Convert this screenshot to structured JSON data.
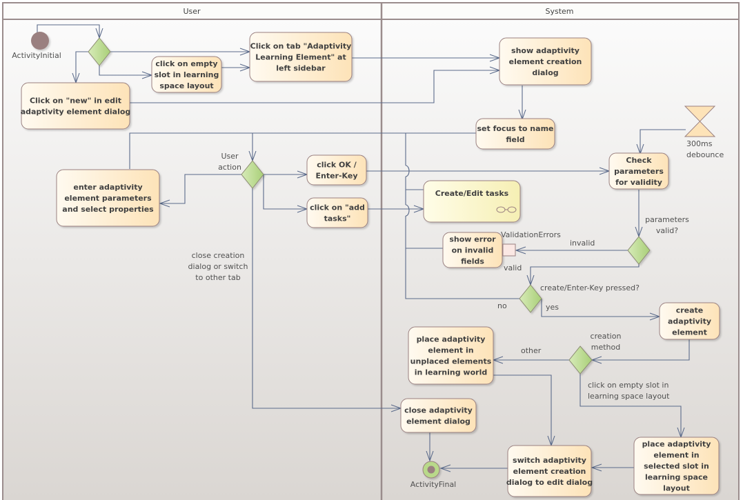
{
  "diagram": {
    "type": "UML activity diagram",
    "lanes": [
      {
        "id": "user",
        "title": "User"
      },
      {
        "id": "system",
        "title": "System"
      }
    ],
    "colors": {
      "action_fill_start": "#fffaf0",
      "action_fill_end": "#fde3b8",
      "activity_fill_start": "#fffde8",
      "activity_fill_end": "#f6efb4",
      "decision_fill": "#b9d98a",
      "edge": "#5a6a8a",
      "initial_node": "#9a8080",
      "final_ring": "#b9d98a"
    },
    "nodes": {
      "initial": {
        "label": "ActivityInitial"
      },
      "final": {
        "label": "ActivityFinal"
      },
      "click_tab": {
        "lines": [
          "Click on tab \"Adaptivity",
          "Learning Element\" at",
          "left sidebar"
        ]
      },
      "click_empty_slot": {
        "lines": [
          "click on empty",
          "slot in learning",
          "space layout"
        ]
      },
      "click_new": {
        "lines": [
          "Click on \"new\" in edit",
          "adaptivity element dialog"
        ]
      },
      "enter_params": {
        "lines": [
          "enter adaptivity",
          "element parameters",
          "and select properties"
        ]
      },
      "click_ok": {
        "lines": [
          "click OK /",
          "Enter-Key"
        ]
      },
      "click_add_tasks": {
        "lines": [
          "click on \"add",
          "tasks\""
        ]
      },
      "show_dialog": {
        "lines": [
          "show adaptivity",
          "element creation",
          "dialog"
        ]
      },
      "set_focus": {
        "lines": [
          "set focus to name",
          "field"
        ]
      },
      "check_params": {
        "lines": [
          "Check",
          "parameters",
          "for validity"
        ]
      },
      "create_edit_tasks": {
        "lines": [
          "Create/Edit tasks"
        ]
      },
      "show_error": {
        "lines": [
          "show error",
          "on invalid",
          "fields"
        ]
      },
      "create_element": {
        "lines": [
          "create",
          "adaptivity",
          "element"
        ]
      },
      "place_unplaced": {
        "lines": [
          "place adaptivity",
          "element in",
          "unplaced elements",
          "in learning world"
        ]
      },
      "close_dialog": {
        "lines": [
          "close adaptivity",
          "element dialog"
        ]
      },
      "switch_dialog": {
        "lines": [
          "switch adaptivity",
          "element creation",
          "dialog to edit dialog"
        ]
      },
      "place_selected": {
        "lines": [
          "place adaptivity",
          "element in",
          "selected slot in",
          "learning space",
          "layout"
        ]
      },
      "timer": {
        "lines": [
          "300ms",
          "debounce"
        ]
      },
      "pin": {
        "label": "ValidationErrors"
      }
    },
    "decisions": {
      "user_action": {
        "lines": [
          "User",
          "action"
        ]
      },
      "params_valid": {
        "lines": [
          "parameters",
          "valid?"
        ]
      },
      "create_pressed": {
        "label": "create/Enter-Key pressed?"
      },
      "creation_method": {
        "lines": [
          "creation",
          "method"
        ]
      }
    },
    "guards": {
      "close_switch": [
        "close creation",
        "dialog or switch",
        "to other tab"
      ],
      "invalid": "invalid",
      "valid": "valid",
      "no": "no",
      "yes": "yes",
      "other": "other",
      "empty_slot": [
        "click on empty slot in",
        "learning space layout"
      ]
    }
  }
}
